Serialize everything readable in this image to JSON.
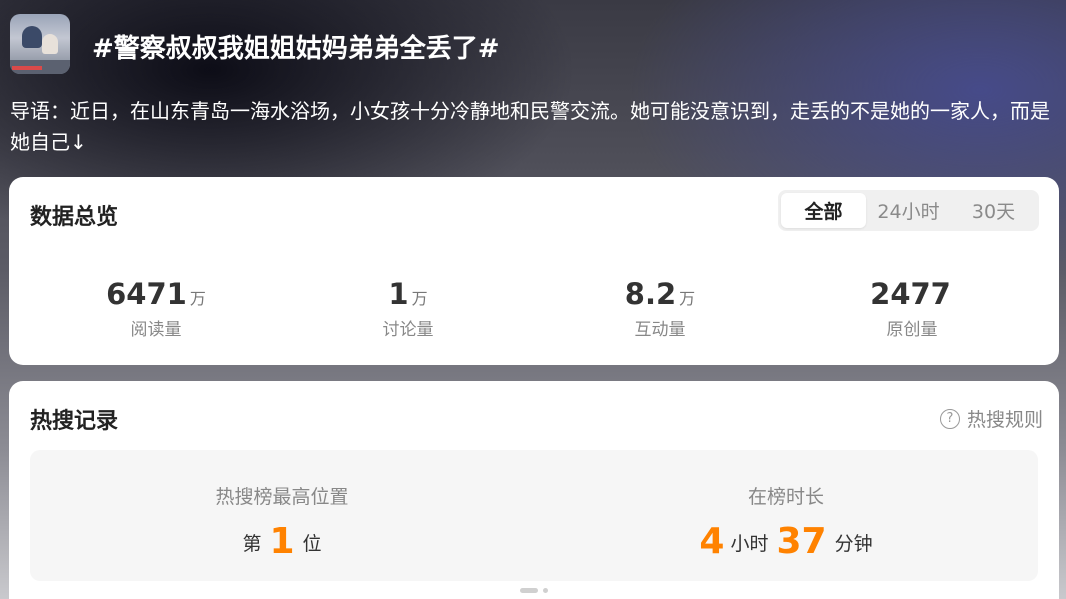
{
  "topic": {
    "title": "#警察叔叔我姐姐姑妈弟弟全丢了#",
    "lead": "导语：近日，在山东青岛一海水浴场，小女孩十分冷静地和民警交流。她可能没意识到，走丢的不是她的一家人，而是她自己↓"
  },
  "overview": {
    "title": "数据总览",
    "tabs": [
      {
        "label": "全部",
        "active": true
      },
      {
        "label": "24小时",
        "active": false
      },
      {
        "label": "30天",
        "active": false
      }
    ],
    "stats": [
      {
        "value": "6471",
        "unit": "万",
        "label": "阅读量"
      },
      {
        "value": "1",
        "unit": "万",
        "label": "讨论量"
      },
      {
        "value": "8.2",
        "unit": "万",
        "label": "互动量"
      },
      {
        "value": "2477",
        "unit": "",
        "label": "原创量"
      }
    ]
  },
  "hot": {
    "title": "热搜记录",
    "rule_link": "热搜规则",
    "highest": {
      "label": "热搜榜最高位置",
      "prefix": "第",
      "value": "1",
      "suffix": "位"
    },
    "duration": {
      "label": "在榜时长",
      "hours": "4",
      "hours_unit": "小时",
      "minutes": "37",
      "minutes_unit": "分钟"
    }
  },
  "colors": {
    "accent": "#ff8200",
    "card_bg": "#ffffff",
    "panel_bg": "#f6f6f6"
  },
  "icons": {
    "rule": "question-circle-icon"
  }
}
